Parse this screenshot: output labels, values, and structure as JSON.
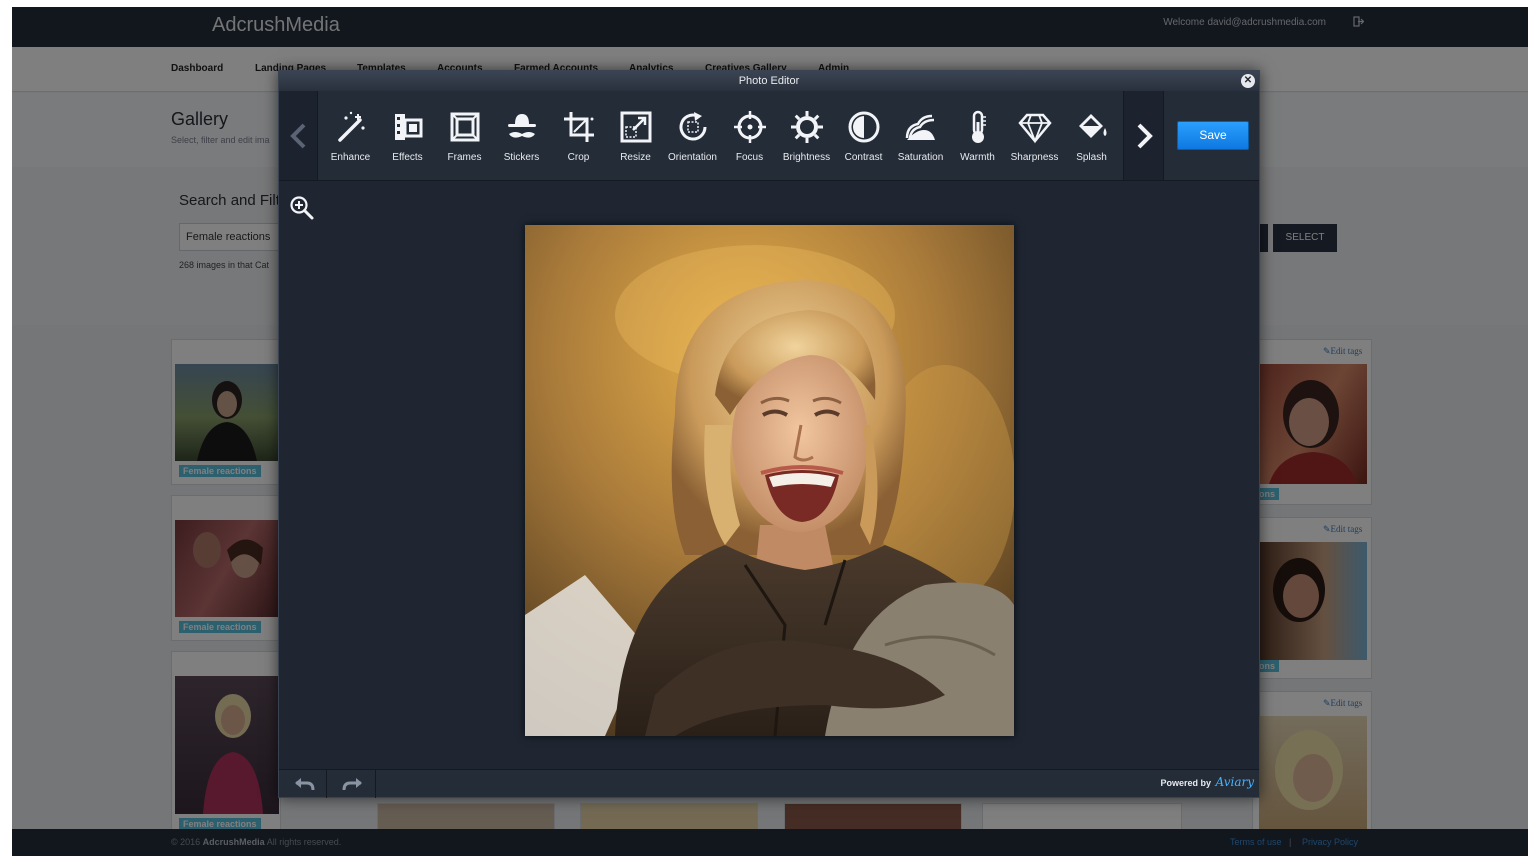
{
  "app": {
    "brand": "AdcrushMedia",
    "welcome": "Welcome david@adcrushmedia.com",
    "logout_icon": "sign-out-icon"
  },
  "nav": {
    "items": [
      "Dashboard",
      "Landing Pages",
      "Templates",
      "Accounts",
      "Farmed Accounts",
      "Analytics",
      "Creatives Gallery",
      "Admin"
    ]
  },
  "gallery": {
    "title": "Gallery",
    "subtitle": "Select, filter and edit ima",
    "search_title": "Search and Filt",
    "search_value": "Female reactions",
    "count_text": "268 images in that Cat",
    "select_label": "SELECT",
    "tag_label": "Female reactions",
    "tag_partial": "ons",
    "edit_tags": "Edit tags"
  },
  "footer": {
    "copyright_prefix": "© 2016",
    "copyright_brand": "AdcrushMedia",
    "copyright_suffix": "All rights reserved.",
    "terms": "Terms of use",
    "separator": "|",
    "privacy": "Privacy Policy"
  },
  "editor": {
    "title": "Photo Editor",
    "close_icon": "close-icon",
    "tools": [
      {
        "label": "Enhance",
        "icon": "magic-wand-icon"
      },
      {
        "label": "Effects",
        "icon": "film-icon"
      },
      {
        "label": "Frames",
        "icon": "frame-icon"
      },
      {
        "label": "Stickers",
        "icon": "hat-mustache-icon"
      },
      {
        "label": "Crop",
        "icon": "crop-icon"
      },
      {
        "label": "Resize",
        "icon": "resize-icon"
      },
      {
        "label": "Orientation",
        "icon": "rotate-icon"
      },
      {
        "label": "Focus",
        "icon": "crosshair-icon"
      },
      {
        "label": "Brightness",
        "icon": "sun-icon"
      },
      {
        "label": "Contrast",
        "icon": "contrast-icon"
      },
      {
        "label": "Saturation",
        "icon": "saturation-icon"
      },
      {
        "label": "Warmth",
        "icon": "thermometer-icon"
      },
      {
        "label": "Sharpness",
        "icon": "diamond-icon"
      },
      {
        "label": "Splash",
        "icon": "paint-bucket-icon"
      }
    ],
    "save_label": "Save",
    "powered_by": "Powered by",
    "aviary": "Aviary",
    "colors": {
      "save": "#1a8cf0",
      "panel": "#1f2632",
      "accent_text": "#45b4ff"
    }
  }
}
